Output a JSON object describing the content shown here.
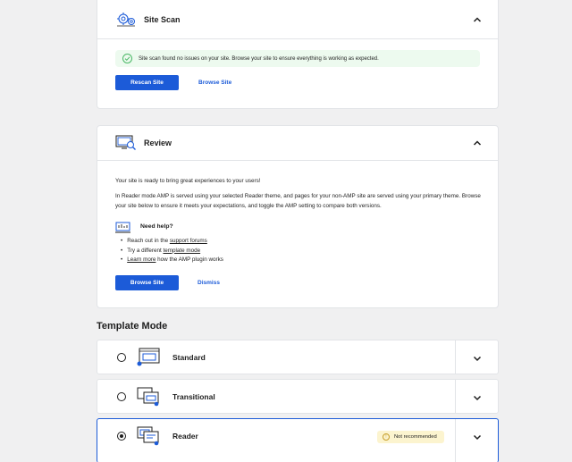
{
  "site_scan": {
    "title": "Site Scan",
    "notice": "Site scan found no issues on your site. Browse your site to ensure everything is working as expected.",
    "rescan_label": "Rescan Site",
    "browse_label": "Browse Site",
    "icon": "gears-icon"
  },
  "review": {
    "title": "Review",
    "intro": "Your site is ready to bring great experiences to your users!",
    "description": "In Reader mode AMP is served using your selected Reader theme, and pages for your non-AMP site are served using your primary theme. Browse your site below to ensure it meets your expectations, and toggle the AMP setting to compare both versions.",
    "help_title": "Need help?",
    "help_items": [
      {
        "before": "Reach out in the ",
        "link": "support forums",
        "after": ""
      },
      {
        "before": "Try a different ",
        "link": "template mode",
        "after": ""
      },
      {
        "before": "",
        "link": "Learn more",
        "after": " how the AMP plugin works"
      }
    ],
    "browse_label": "Browse Site",
    "dismiss_label": "Dismiss"
  },
  "template_mode": {
    "title": "Template Mode",
    "modes": [
      {
        "label": "Standard",
        "selected": false
      },
      {
        "label": "Transitional",
        "selected": false
      },
      {
        "label": "Reader",
        "selected": true,
        "badge": "Not recommended"
      }
    ]
  },
  "colors": {
    "accent": "#1c5bd8",
    "success_bg": "#edfaef",
    "warning_bg": "#fcf4cf"
  }
}
